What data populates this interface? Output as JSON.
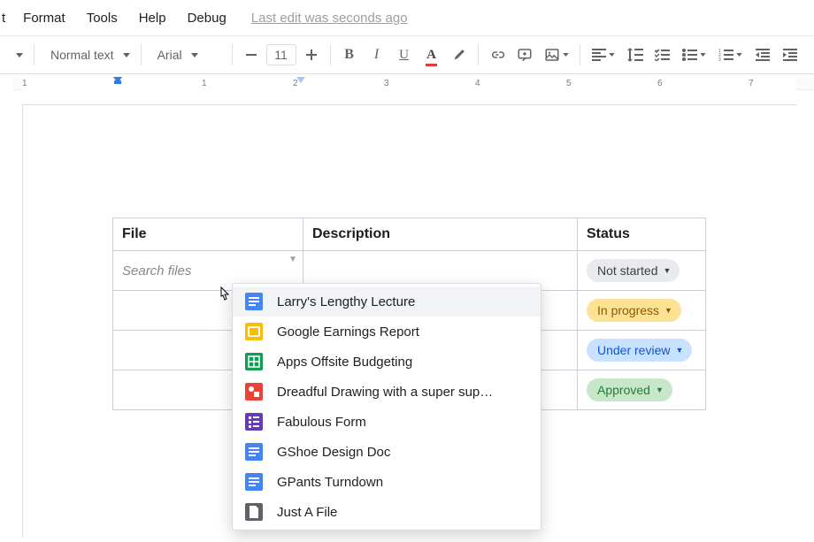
{
  "menu": {
    "items": [
      "t",
      "Format",
      "Tools",
      "Help",
      "Debug"
    ],
    "status": "Last edit was seconds ago"
  },
  "toolbar": {
    "style_label": "Normal text",
    "font_label": "Arial",
    "font_size": "11"
  },
  "ruler": {
    "ticks": [
      "1",
      "1",
      "2",
      "3",
      "4",
      "5",
      "6",
      "7"
    ]
  },
  "table": {
    "headers": {
      "file": "File",
      "desc": "Description",
      "status": "Status"
    },
    "file_placeholder": "Search files",
    "statuses": [
      {
        "label": "Not started",
        "variant": "grey"
      },
      {
        "label": "In progress",
        "variant": "yellow"
      },
      {
        "label": "Under review",
        "variant": "blue"
      },
      {
        "label": "Approved",
        "variant": "green"
      }
    ]
  },
  "suggestions": [
    {
      "icon": "doc",
      "label": "Larry's Lengthy Lecture"
    },
    {
      "icon": "slide",
      "label": "Google Earnings Report"
    },
    {
      "icon": "sheet",
      "label": "Apps Offsite Budgeting"
    },
    {
      "icon": "draw",
      "label": "Dreadful Drawing with a super sup…"
    },
    {
      "icon": "form",
      "label": "Fabulous Form"
    },
    {
      "icon": "doc",
      "label": "GShoe Design Doc"
    },
    {
      "icon": "doc",
      "label": "GPants Turndown"
    },
    {
      "icon": "file",
      "label": "Just A File"
    }
  ]
}
